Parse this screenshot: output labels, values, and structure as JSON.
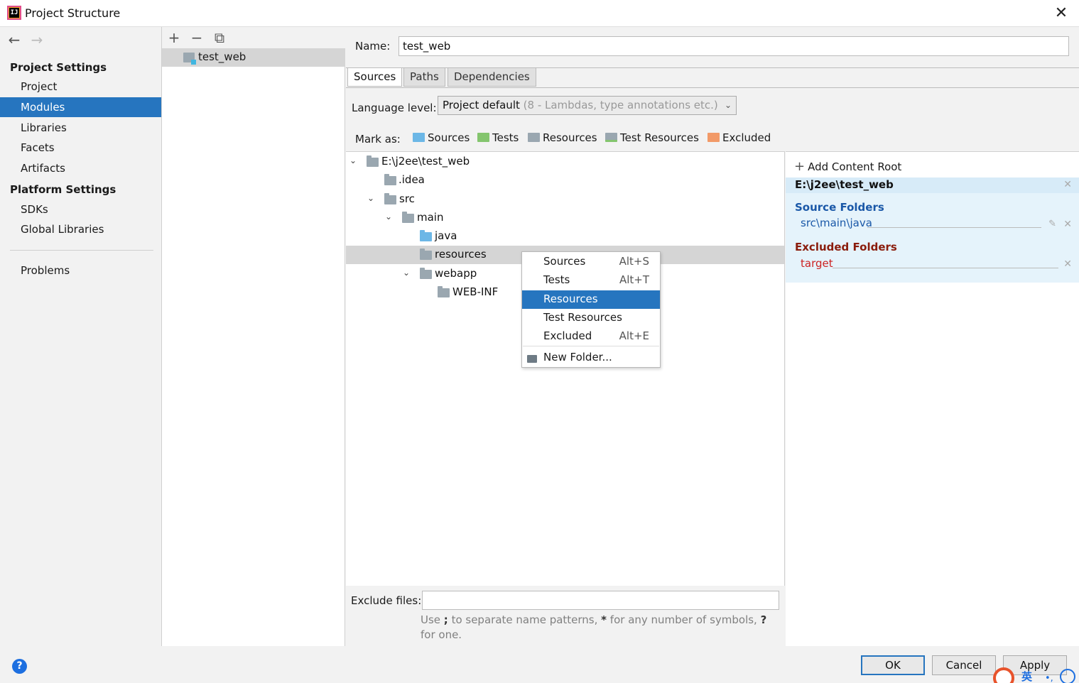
{
  "window": {
    "title": "Project Structure",
    "icon_label": "IJ",
    "close_glyph": "✕"
  },
  "nav": {
    "back": "←",
    "forward": "→"
  },
  "sidebar": {
    "project_settings_header": "Project Settings",
    "project_settings_items": [
      "Project",
      "Modules",
      "Libraries",
      "Facets",
      "Artifacts"
    ],
    "platform_settings_header": "Platform Settings",
    "platform_settings_items": [
      "SDKs",
      "Global Libraries"
    ],
    "problems": "Problems",
    "selected": "Modules"
  },
  "modules_panel": {
    "toolbar": {
      "add": "+",
      "remove": "−",
      "copy": "⧉"
    },
    "items": [
      "test_web"
    ]
  },
  "module": {
    "name_label": "Name:",
    "name_value": "test_web",
    "tabs": [
      "Sources",
      "Paths",
      "Dependencies"
    ],
    "active_tab": "Sources",
    "language_level_label": "Language level:",
    "language_level_value": "Project default",
    "language_level_hint": "(8 - Lambdas, type annotations etc.)",
    "mark_as_label": "Mark as:",
    "mark_as": [
      {
        "label": "Sources",
        "color": "#6cb7e6"
      },
      {
        "label": "Tests",
        "color": "#84c56e"
      },
      {
        "label": "Resources",
        "color": "#9aa7b0"
      },
      {
        "label": "Test Resources",
        "color": "#9aa7b0"
      },
      {
        "label": "Excluded",
        "color": "#f29a68"
      }
    ]
  },
  "tree": {
    "nodes": [
      {
        "label": "E:\\j2ee\\test_web",
        "expanded": true
      },
      {
        "label": ".idea"
      },
      {
        "label": "src",
        "expanded": true
      },
      {
        "label": "main",
        "expanded": true
      },
      {
        "label": "java",
        "kind": "source"
      },
      {
        "label": "resources",
        "selected": true
      },
      {
        "label": "webapp",
        "expanded": true
      },
      {
        "label": "WEB-INF"
      }
    ],
    "chevron_glyph": "⌄"
  },
  "context_menu": {
    "items": [
      {
        "label": "Sources",
        "shortcut": "Alt+S"
      },
      {
        "label": "Tests",
        "shortcut": "Alt+T"
      },
      {
        "label": "Resources",
        "shortcut": "",
        "highlighted": true
      },
      {
        "label": "Test Resources",
        "shortcut": ""
      },
      {
        "label": "Excluded",
        "shortcut": "Alt+E"
      }
    ],
    "new_folder": "New Folder..."
  },
  "exclude": {
    "label": "Exclude files:",
    "value": "",
    "help_1": "Use ",
    "help_semicolon": ";",
    "help_2": " to separate name patterns, ",
    "help_star": "*",
    "help_3": " for any number of symbols, ",
    "help_q": "?",
    "help_4": " for one."
  },
  "content_roots": {
    "add_label": "Add Content Root",
    "root_path": "E:\\j2ee\\test_web",
    "source_folders_header": "Source Folders",
    "source_folders": [
      "src\\main\\java"
    ],
    "excluded_folders_header": "Excluded Folders",
    "excluded_folders": [
      "target"
    ],
    "colors": {
      "source": "#1a58a8",
      "excluded": "#8a1c0c"
    }
  },
  "buttons": {
    "ok": "OK",
    "cancel": "Cancel",
    "apply": "Apply",
    "help": "?"
  },
  "ime": {
    "lang": "英",
    "punct": "•,"
  }
}
